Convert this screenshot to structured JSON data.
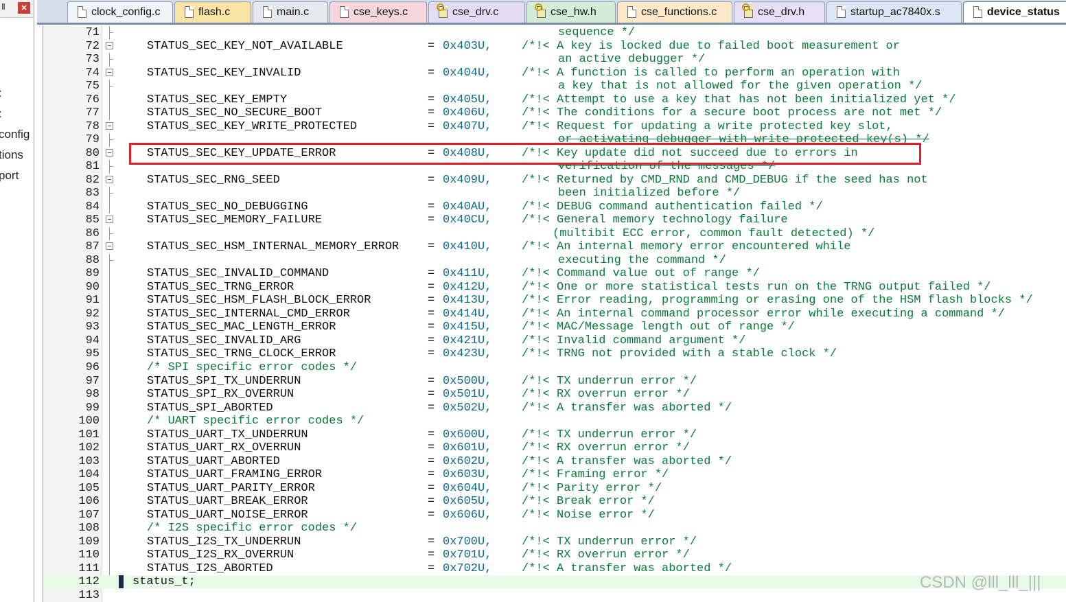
{
  "side_panel": {
    "pin_glyph": "Ⅱ",
    "close_glyph": "×",
    "items": [
      ":",
      ":",
      "config",
      "tions",
      "port"
    ]
  },
  "tabs": [
    {
      "label": "clock_config.c",
      "type": "c",
      "active": false,
      "color": "#f0f3f8"
    },
    {
      "label": "flash.c",
      "type": "c",
      "active": false,
      "color": "#fbe3a5"
    },
    {
      "label": "main.c",
      "type": "c",
      "active": false,
      "color": "#e6e8ee"
    },
    {
      "label": "cse_keys.c",
      "type": "c",
      "active": false,
      "color": "#f7d5dc"
    },
    {
      "label": "cse_drv.c",
      "type": "h",
      "active": false,
      "color": "#e4dcf4"
    },
    {
      "label": "cse_hw.h",
      "type": "h",
      "active": false,
      "color": "#d3ecd8"
    },
    {
      "label": "cse_functions.c",
      "type": "c",
      "active": false,
      "color": "#fde8c8"
    },
    {
      "label": "cse_drv.h",
      "type": "h",
      "active": false,
      "color": "#e7dff5"
    },
    {
      "label": "startup_ac7840x.s",
      "type": "c",
      "active": false,
      "color": "#dde6f4"
    },
    {
      "label": "device_status",
      "type": "c",
      "active": true,
      "color": "#ffffff"
    }
  ],
  "editor": {
    "lines": [
      {
        "n": "71",
        "kind": "cont",
        "comment": "sequence */"
      },
      {
        "n": "72",
        "kind": "entry",
        "fold": true,
        "ident": "STATUS_SEC_KEY_NOT_AVAILABLE",
        "value": "0x403U,",
        "comment": "/*!< A key is locked due to failed boot measurement or"
      },
      {
        "n": "73",
        "kind": "cont",
        "comment": "an active debugger */"
      },
      {
        "n": "74",
        "kind": "entry",
        "fold": true,
        "ident": "STATUS_SEC_KEY_INVALID",
        "value": "0x404U,",
        "comment": "/*!< A function is called to perform an operation with"
      },
      {
        "n": "75",
        "kind": "cont",
        "comment": "a key that is not allowed for the given operation */"
      },
      {
        "n": "76",
        "kind": "entry",
        "ident": "STATUS_SEC_KEY_EMPTY",
        "value": "0x405U,",
        "comment": "/*!< Attempt to use a key that has not been initialized yet */"
      },
      {
        "n": "77",
        "kind": "entry",
        "ident": "STATUS_SEC_NO_SECURE_BOOT",
        "value": "0x406U,",
        "comment": "/*!< The conditions for a secure boot process are not met */"
      },
      {
        "n": "78",
        "kind": "entry",
        "fold": true,
        "ident": "STATUS_SEC_KEY_WRITE_PROTECTED",
        "value": "0x407U,",
        "comment": "/*!< Request for updating a write protected key slot,"
      },
      {
        "n": "79",
        "kind": "cont",
        "strike": true,
        "comment": "or activating debugger with write protected key(s) */"
      },
      {
        "n": "80",
        "kind": "entry",
        "fold": true,
        "ident": "STATUS_SEC_KEY_UPDATE_ERROR",
        "value": "0x408U,",
        "comment": "/*!< Key update did not succeed due to errors in"
      },
      {
        "n": "81",
        "kind": "cont",
        "strike": true,
        "comment": "verification of the messages */"
      },
      {
        "n": "82",
        "kind": "entry",
        "fold": true,
        "ident": "STATUS_SEC_RNG_SEED",
        "value": "0x409U,",
        "comment": "/*!< Returned by CMD_RND and CMD_DEBUG if the seed has not"
      },
      {
        "n": "83",
        "kind": "cont",
        "comment": "been initialized before */"
      },
      {
        "n": "84",
        "kind": "entry",
        "ident": "STATUS_SEC_NO_DEBUGGING",
        "value": "0x40AU,",
        "comment": "/*!< DEBUG command authentication failed */"
      },
      {
        "n": "85",
        "kind": "entry",
        "fold": true,
        "ident": "STATUS_SEC_MEMORY_FAILURE",
        "value": "0x40CU,",
        "comment": "/*!< General memory technology failure"
      },
      {
        "n": "86",
        "kind": "cont2",
        "comment": "(multibit ECC error, common fault detected) */"
      },
      {
        "n": "87",
        "kind": "entry",
        "fold": true,
        "ident": "STATUS_SEC_HSM_INTERNAL_MEMORY_ERROR",
        "value": "0x410U,",
        "comment": "/*!< An internal memory error encountered while"
      },
      {
        "n": "88",
        "kind": "cont",
        "comment": "executing the command */"
      },
      {
        "n": "89",
        "kind": "entry",
        "ident": "STATUS_SEC_INVALID_COMMAND",
        "value": "0x411U,",
        "comment": "/*!< Command value out of range */"
      },
      {
        "n": "90",
        "kind": "entry",
        "ident": "STATUS_SEC_TRNG_ERROR",
        "value": "0x412U,",
        "comment": "/*!< One or more statistical tests run on the TRNG output failed */"
      },
      {
        "n": "91",
        "kind": "entry",
        "ident": "STATUS_SEC_HSM_FLASH_BLOCK_ERROR",
        "value": "0x413U,",
        "comment": "/*!< Error reading, programming or erasing one of the HSM flash blocks */"
      },
      {
        "n": "92",
        "kind": "entry",
        "ident": "STATUS_SEC_INTERNAL_CMD_ERROR",
        "value": "0x414U,",
        "comment": "/*!< An internal command processor error while executing a command */"
      },
      {
        "n": "93",
        "kind": "entry",
        "ident": "STATUS_SEC_MAC_LENGTH_ERROR",
        "value": "0x415U,",
        "comment": "/*!< MAC/Message length out of range */"
      },
      {
        "n": "94",
        "kind": "entry",
        "ident": "STATUS_SEC_INVALID_ARG",
        "value": "0x421U,",
        "comment": "/*!< Invalid command argument */"
      },
      {
        "n": "95",
        "kind": "entry",
        "ident": "STATUS_SEC_TRNG_CLOCK_ERROR",
        "value": "0x423U,",
        "comment": "/*!< TRNG not provided with a stable clock */"
      },
      {
        "n": "96",
        "kind": "section",
        "comment": "/* SPI specific error codes */"
      },
      {
        "n": "97",
        "kind": "entry",
        "ident": "STATUS_SPI_TX_UNDERRUN",
        "value": "0x500U,",
        "comment": "/*!< TX underrun error */"
      },
      {
        "n": "98",
        "kind": "entry",
        "ident": "STATUS_SPI_RX_OVERRUN",
        "value": "0x501U,",
        "comment": "/*!< RX overrun error */"
      },
      {
        "n": "99",
        "kind": "entry",
        "ident": "STATUS_SPI_ABORTED",
        "value": "0x502U,",
        "comment": "/*!< A transfer was aborted */"
      },
      {
        "n": "100",
        "kind": "section",
        "comment": "/* UART specific error codes */"
      },
      {
        "n": "101",
        "kind": "entry",
        "ident": "STATUS_UART_TX_UNDERRUN",
        "value": "0x600U,",
        "comment": "/*!< TX underrun error */"
      },
      {
        "n": "102",
        "kind": "entry",
        "ident": "STATUS_UART_RX_OVERRUN",
        "value": "0x601U,",
        "comment": "/*!< RX overrun error */"
      },
      {
        "n": "103",
        "kind": "entry",
        "ident": "STATUS_UART_ABORTED",
        "value": "0x602U,",
        "comment": "/*!< A transfer was aborted */"
      },
      {
        "n": "104",
        "kind": "entry",
        "ident": "STATUS_UART_FRAMING_ERROR",
        "value": "0x603U,",
        "comment": "/*!< Framing error */"
      },
      {
        "n": "105",
        "kind": "entry",
        "ident": "STATUS_UART_PARITY_ERROR",
        "value": "0x604U,",
        "comment": "/*!< Parity error */"
      },
      {
        "n": "106",
        "kind": "entry",
        "ident": "STATUS_UART_BREAK_ERROR",
        "value": "0x605U,",
        "comment": "/*!< Break error */"
      },
      {
        "n": "107",
        "kind": "entry",
        "ident": "STATUS_UART_NOISE_ERROR",
        "value": "0x606U,",
        "comment": "/*!< Noise error */"
      },
      {
        "n": "108",
        "kind": "section",
        "comment": "/* I2S specific error codes */"
      },
      {
        "n": "109",
        "kind": "entry",
        "ident": "STATUS_I2S_TX_UNDERRUN",
        "value": "0x700U,",
        "comment": "/*!< TX underrun error */"
      },
      {
        "n": "110",
        "kind": "entry",
        "ident": "STATUS_I2S_RX_OVERRUN",
        "value": "0x701U,",
        "comment": "/*!< RX overrun error */"
      },
      {
        "n": "111",
        "kind": "entry",
        "ident": "STATUS_I2S_ABORTED",
        "value": "0x702U,",
        "comment": "/*!< A transfer was aborted */"
      },
      {
        "n": "112",
        "kind": "closing",
        "current": true,
        "text": "status_t;"
      },
      {
        "n": "113",
        "kind": "blank"
      }
    ],
    "highlighted_line": "80",
    "highlight_color": "#e01e26"
  },
  "watermark": "CSDN @lll_lll_|||"
}
